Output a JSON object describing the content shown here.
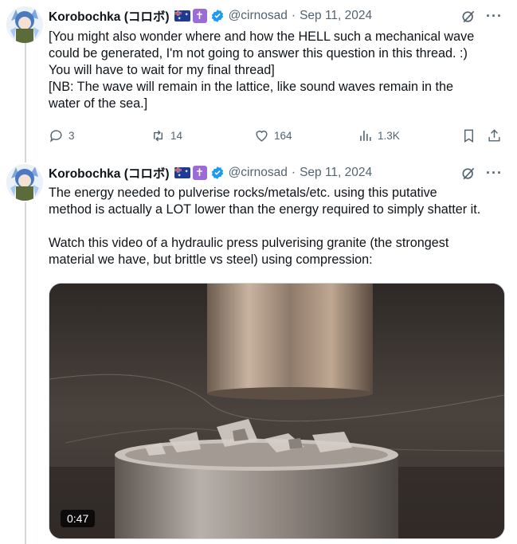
{
  "tweets": [
    {
      "author": {
        "name": "Korobochka (コロボ)",
        "handle": "@cirnosad",
        "date": "Sep 11, 2024"
      },
      "lines": [
        "[You might also wonder where and how the HELL such a mechanical wave",
        "could be generated, I'm not going to answer this question in this thread. :)",
        "You will have to wait for my final thread]",
        "[NB: The wave will remain in the lattice, like sound waves remain in the",
        "water of the sea.]"
      ],
      "stats": {
        "replies": "3",
        "reposts": "14",
        "likes": "164",
        "views": "1.3K"
      }
    },
    {
      "author": {
        "name": "Korobochka (コロボ)",
        "handle": "@cirnosad",
        "date": "Sep 11, 2024"
      },
      "lines": [
        "The energy needed to pulverise rocks/metals/etc. using this putative",
        "method is actually a LOT lower than the energy required to simply shatter it.",
        "",
        "Watch this video of a hydraulic press pulverising granite (the strongest",
        "material we have, but brittle vs steel) using compression:"
      ],
      "video": {
        "duration": "0:47"
      }
    }
  ],
  "icons": {
    "verified": "verified-badge-icon",
    "grok": "grok-icon",
    "more": "more-icon",
    "reply": "reply-icon",
    "repost": "repost-icon",
    "like": "like-icon",
    "views": "views-icon",
    "bookmark": "bookmark-icon",
    "share": "share-icon"
  },
  "colors": {
    "verified": "#1d9bf0",
    "secondary_text": "#536471",
    "cross_badge": "#9b6bd6"
  }
}
